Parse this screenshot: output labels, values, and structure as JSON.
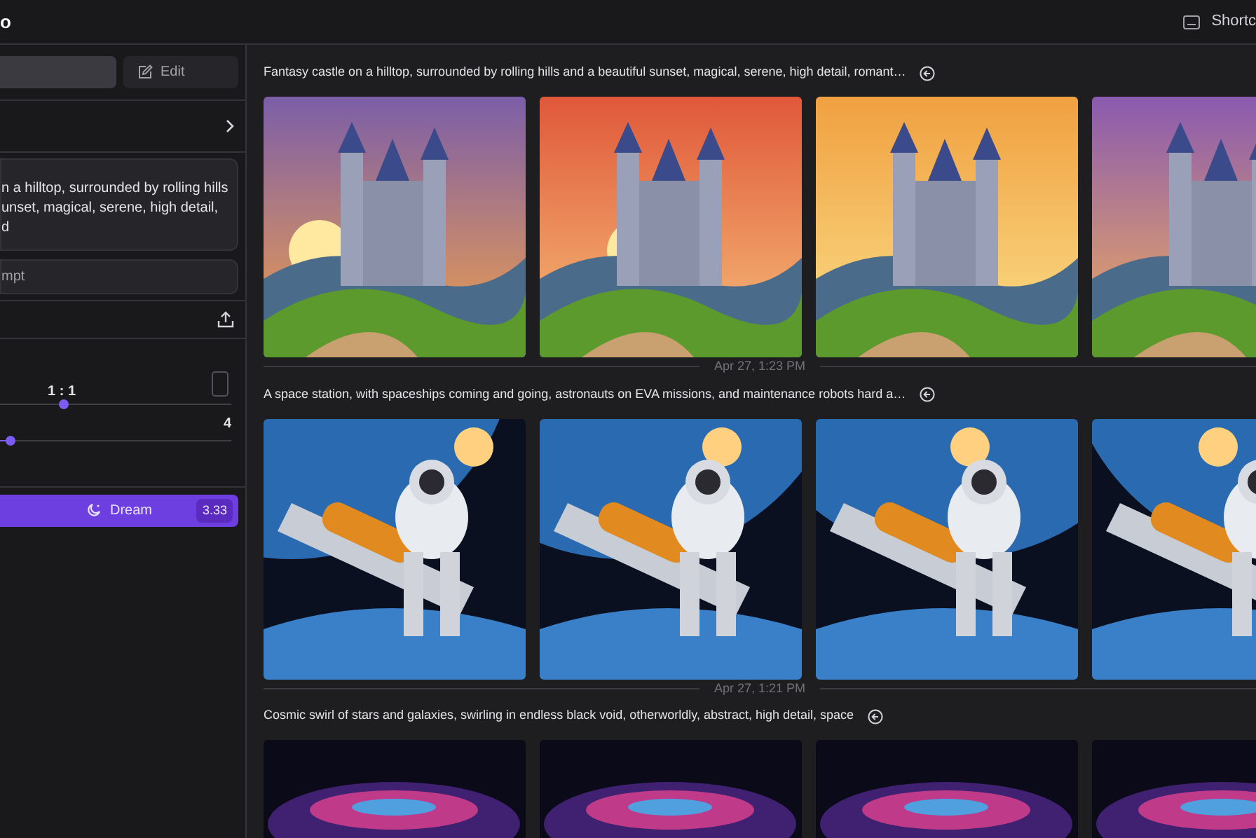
{
  "app_title": "o",
  "shortcuts": {
    "label": "Shortc"
  },
  "tabs": [
    {
      "selected": true
    },
    {
      "label": "Edit",
      "selected": false
    }
  ],
  "prompt": {
    "lines": [
      "n a hilltop, surrounded by rolling hills",
      "unset, magical, serene, high detail,",
      "d"
    ]
  },
  "negative_prompt": {
    "placeholder": "mpt"
  },
  "aspect": {
    "reading": "1 : 1",
    "level": 0.27
  },
  "count": {
    "reading": "4",
    "level": 0.04
  },
  "dream_button": {
    "label": "Dream",
    "cost": "3.33"
  },
  "groups": [
    {
      "prompt": "Fantasy castle on a hilltop, surrounded by rolling hills and a beautiful sunset, magical, serene, high detail, romant…"
    },
    {
      "time": "Apr 27, 1:23 PM",
      "prompt": "A space station, with spaceships coming and going, astronauts on EVA missions, and maintenance robots hard a…"
    },
    {
      "time": "Apr 27, 1:21 PM",
      "prompt": "Cosmic swirl of stars and galaxies, swirling in endless black void, otherworldly, abstract, high detail, space"
    }
  ]
}
